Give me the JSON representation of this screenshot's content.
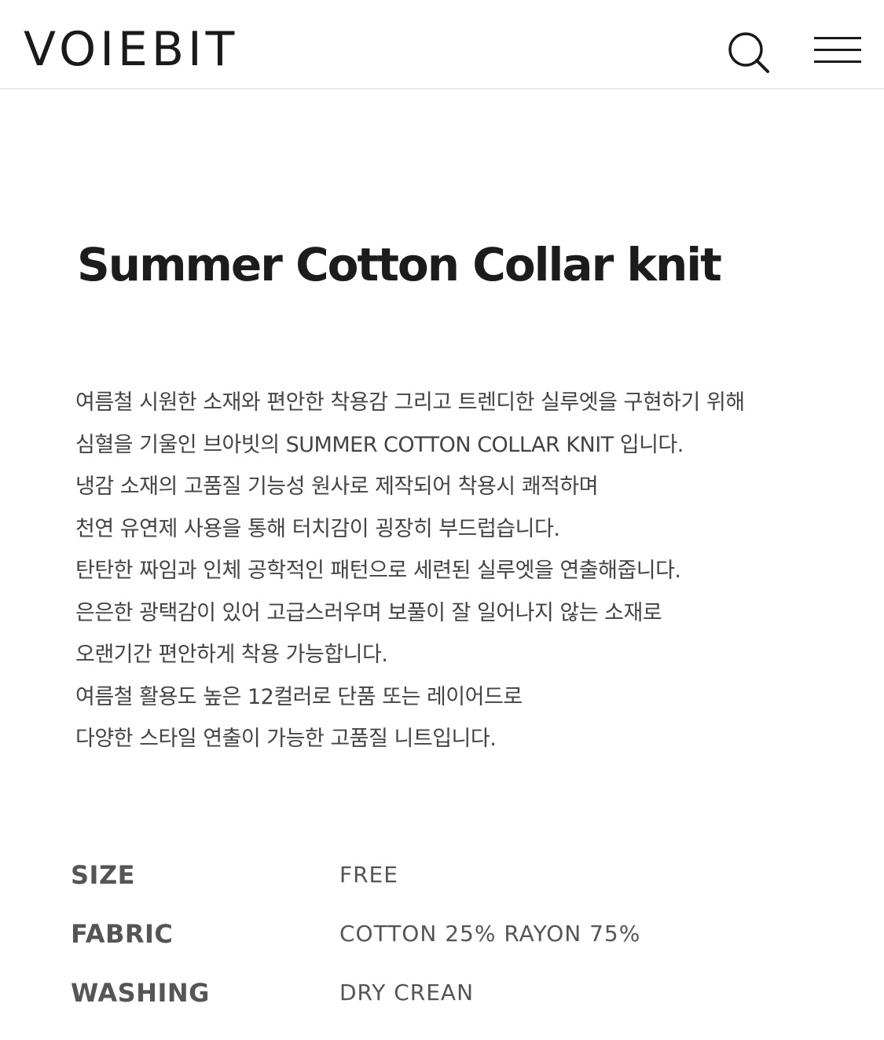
{
  "header": {
    "logo": "VOIEBIT",
    "search_icon": "search-icon",
    "menu_icon": "hamburger-menu-icon"
  },
  "product": {
    "title": "Summer Cotton Collar knit",
    "description_lines": [
      "여름철 시원한 소재와 편안한 착용감 그리고 트렌디한 실루엣을 구현하기 위해",
      "심혈을 기울인 브아빗의 SUMMER COTTON COLLAR KNIT 입니다.",
      "냉감 소재의 고품질 기능성 원사로 제작되어 착용시 쾌적하며",
      "천연 유연제 사용을 통해 터치감이 굉장히 부드럽습니다.",
      "탄탄한 짜임과 인체 공학적인 패턴으로 세련된 실루엣을 연출해줍니다.",
      "은은한 광택감이 있어 고급스러우며 보풀이 잘 일어나지 않는 소재로",
      "오랜기간 편안하게 착용 가능합니다.",
      "여름철 활용도 높은 12컬러로 단품 또는 레이어드로",
      "다양한 스타일 연출이 가능한 고품질 니트입니다."
    ]
  },
  "specs": [
    {
      "label": "SIZE",
      "value": "FREE"
    },
    {
      "label": "FABRIC",
      "value": "COTTON 25% RAYON 75%"
    },
    {
      "label": "WASHING",
      "value": "DRY CREAN"
    }
  ],
  "colors": {
    "text_dark": "#1a1a1a",
    "text_body": "#444444",
    "text_spec": "#555555",
    "divider": "#ececec"
  }
}
